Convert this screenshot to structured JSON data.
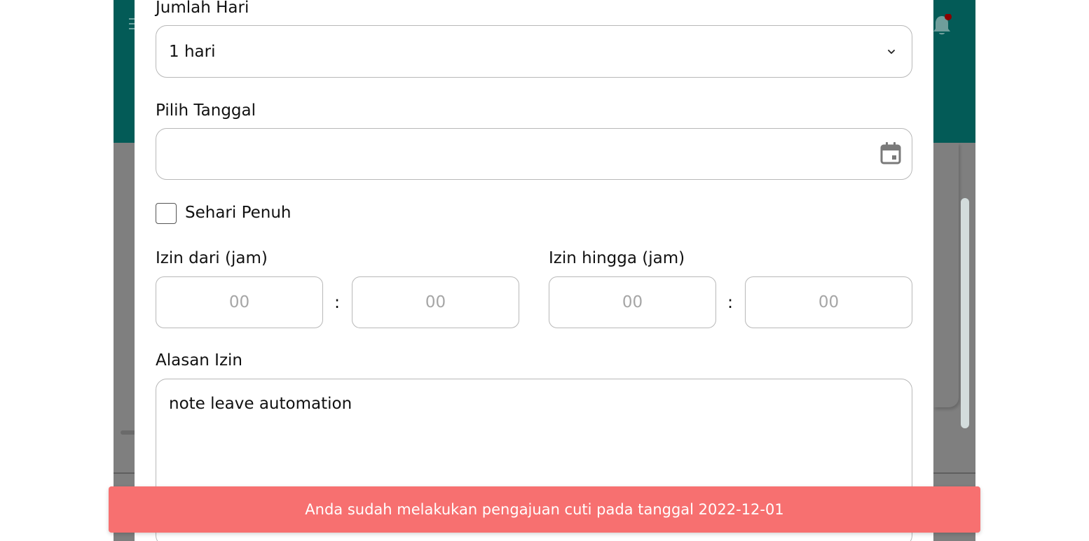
{
  "form": {
    "days_label": "Jumlah Hari",
    "days_value": "1 hari",
    "date_label": "Pilih Tanggal",
    "date_value": "",
    "full_day_label": "Sehari Penuh",
    "full_day_checked": false,
    "time_from_label": "Izin dari (jam)",
    "time_to_label": "Izin hingga (jam)",
    "time_from_hour": "00",
    "time_from_minute": "00",
    "time_to_hour": "00",
    "time_to_minute": "00",
    "time_separator": ":",
    "reason_label": "Alasan Izin",
    "reason_value": "note leave automation"
  },
  "toast": {
    "message": "Anda sudah melakukan pengajuan cuti pada tanggal 2022-12-01",
    "color": "#f77070"
  },
  "icons": {
    "menu": "hamburger-icon",
    "notifications": "bell-icon",
    "dropdown": "chevron-down-icon",
    "calendar": "calendar-icon"
  },
  "colors": {
    "header": "#035b57",
    "overlay": "#7f7f7f",
    "notification_dot": "#8b0000"
  }
}
